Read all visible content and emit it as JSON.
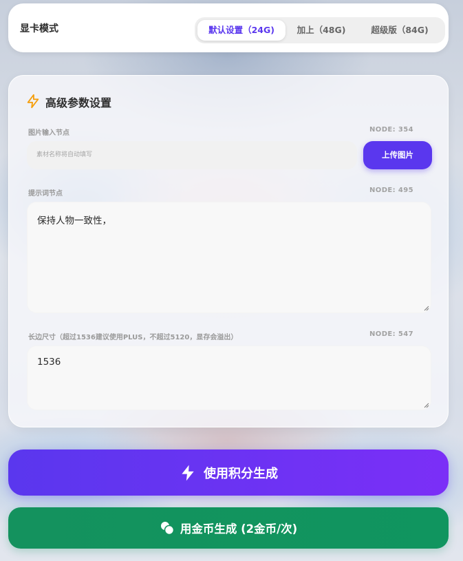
{
  "gpu_mode": {
    "label": "显卡模式",
    "options": [
      {
        "label": "默认设置（24G)",
        "active": true
      },
      {
        "label": "加上（48G)",
        "active": false
      },
      {
        "label": "超级版（84G)",
        "active": false
      }
    ]
  },
  "advanced": {
    "title": "高级参数设置",
    "title_icon": "lightning-icon",
    "image_input": {
      "label": "图片输入节点",
      "node": "NODE: 354",
      "placeholder": "素材名称将自动填写",
      "upload_label": "上传图片"
    },
    "prompt": {
      "label": "提示词节点",
      "node": "NODE: 495",
      "value": "保持人物一致性，"
    },
    "long_edge": {
      "label": "长边尺寸（超过1536建议使用PLUS，不超过5120，显存会溢出）",
      "node": "NODE: 547",
      "value": "1536"
    }
  },
  "actions": {
    "points_label": "使用积分生成",
    "coins_label": "用金币生成 (2金币/次)"
  },
  "colors": {
    "accent": "#5a37ee",
    "accent_gradient_end": "#7b2ff7",
    "coin_green": "#10955f",
    "icon_orange": "#f59e0b"
  }
}
